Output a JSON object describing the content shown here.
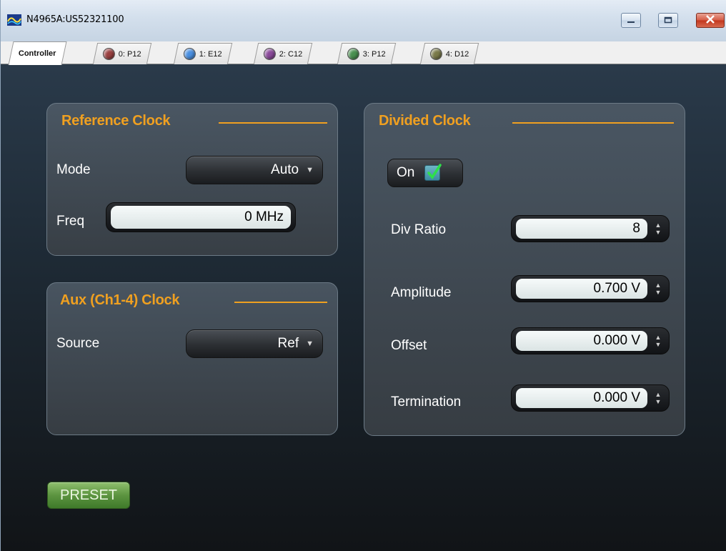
{
  "window": {
    "title": "N4965A:US52321100"
  },
  "tabs": [
    {
      "label": "Controller",
      "dot_color": null,
      "active": true
    },
    {
      "label": "0: P12",
      "dot_color": "#9a4040",
      "active": false
    },
    {
      "label": "1: E12",
      "dot_color": "#4a8fe0",
      "active": false
    },
    {
      "label": "2: C12",
      "dot_color": "#8a4a9a",
      "active": false
    },
    {
      "label": "3: P12",
      "dot_color": "#4a9050",
      "active": false
    },
    {
      "label": "4: D12",
      "dot_color": "#7a7a4a",
      "active": false
    }
  ],
  "reference_clock": {
    "title": "Reference Clock",
    "mode_label": "Mode",
    "mode_value": "Auto",
    "freq_label": "Freq",
    "freq_value": "0 MHz"
  },
  "aux_clock": {
    "title": "Aux (Ch1-4) Clock",
    "source_label": "Source",
    "source_value": "Ref"
  },
  "divided_clock": {
    "title": "Divided Clock",
    "on_label": "On",
    "on_checked": true,
    "div_ratio_label": "Div Ratio",
    "div_ratio_value": "8",
    "amplitude_label": "Amplitude",
    "amplitude_value": "0.700 V",
    "offset_label": "Offset",
    "offset_value": "0.000 V",
    "termination_label": "Termination",
    "termination_value": "0.000 V"
  },
  "preset_label": "PRESET",
  "colors": {
    "accent": "#f0a020",
    "preset_green": "#5c9440"
  }
}
